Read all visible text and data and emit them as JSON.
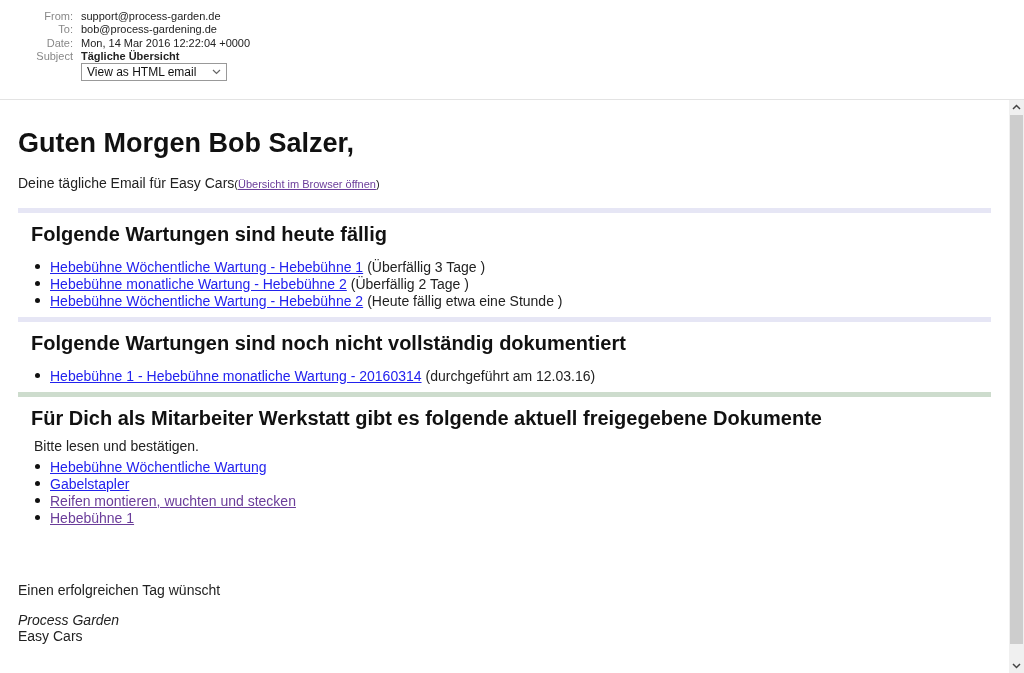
{
  "header": {
    "fields": [
      {
        "label": "From:",
        "value": "support@process-garden.de",
        "bold": false
      },
      {
        "label": "To:",
        "value": "bob@process-gardening.de",
        "bold": false
      },
      {
        "label": "Date:",
        "value": "Mon, 14 Mar 2016 12:22:04 +0000",
        "bold": false
      },
      {
        "label": "Subject",
        "value": "Tägliche Übersicht",
        "bold": true
      }
    ],
    "view_select": "View as HTML email"
  },
  "greeting": "Guten Morgen Bob Salzer,",
  "intro": {
    "text": "Deine tägliche Email für Easy Cars",
    "open_paren": "(",
    "link": "Übersicht im Browser öffnen",
    "visited": true,
    "close_paren": ")"
  },
  "sections": [
    {
      "title": "Folgende Wartungen sind heute fällig",
      "color": "#e6e6f5",
      "items": [
        {
          "link": "Hebebühne Wöchentliche Wartung - Hebebühne 1",
          "visited": false,
          "note": "(Überfällig 3 Tage )"
        },
        {
          "link": "Hebebühne monatliche Wartung - Hebebühne 2",
          "visited": false,
          "note": "(Überfällig 2 Tage )"
        },
        {
          "link": "Hebebühne Wöchentliche Wartung - Hebebühne 2",
          "visited": false,
          "note": "(Heute fällig etwa eine Stunde )"
        }
      ]
    },
    {
      "title": "Folgende Wartungen sind noch nicht vollständig dokumentiert",
      "color": "#e6e6f5",
      "items": [
        {
          "link": "Hebebühne 1 - Hebebühne monatliche Wartung - 20160314",
          "visited": false,
          "note": "(durchgeführt am 12.03.16)"
        }
      ]
    },
    {
      "title": "Für Dich als Mitarbeiter Werkstatt gibt es folgende aktuell freigegebene Dokumente",
      "color": "#cddccd",
      "text": "Bitte lesen und bestätigen.",
      "items": [
        {
          "link": "Hebebühne Wöchentliche Wartung",
          "visited": false
        },
        {
          "link": "Gabelstapler",
          "visited": false
        },
        {
          "link": "Reifen montieren, wuchten und stecken",
          "visited": true
        },
        {
          "link": "Hebebühne 1",
          "visited": true
        }
      ]
    }
  ],
  "closing": "Einen erfolgreichen Tag wünscht",
  "signature": {
    "name": "Process Garden",
    "company": "Easy Cars"
  }
}
